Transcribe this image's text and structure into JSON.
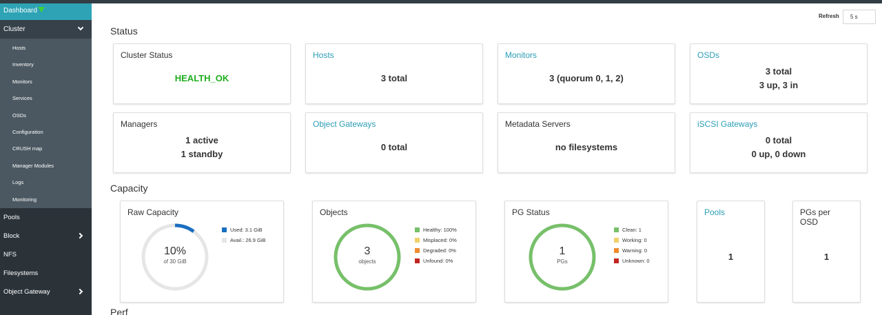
{
  "colors": {
    "accent": "#2ea3b5",
    "link": "#2b9db5",
    "healthy": "#77c06a",
    "ok_text": "#1fad1f",
    "used": "#1a6ec0"
  },
  "sidebar": {
    "dashboard": "Dashboard",
    "cluster": "Cluster",
    "cluster_items": [
      "Hosts",
      "Inventory",
      "Monitors",
      "Services",
      "OSDs",
      "Configuration",
      "CRUSH map",
      "Manager Modules",
      "Logs",
      "Monitoring"
    ],
    "pools": "Pools",
    "block": "Block",
    "nfs": "NFS",
    "filesystems": "Filesystems",
    "object_gateway": "Object Gateway"
  },
  "refresh": {
    "label": "Refresh",
    "value": "5 s"
  },
  "status": {
    "heading": "Status",
    "cluster_status": {
      "title": "Cluster Status",
      "value": "HEALTH_OK"
    },
    "hosts": {
      "title": "Hosts",
      "value": "3 total"
    },
    "monitors": {
      "title": "Monitors",
      "value": "3 (quorum 0, 1, 2)"
    },
    "osds": {
      "title": "OSDs",
      "line1": "3 total",
      "line2": "3 up, 3 in"
    },
    "managers": {
      "title": "Managers",
      "line1": "1 active",
      "line2": "1 standby"
    },
    "object_gateways": {
      "title": "Object Gateways",
      "value": "0 total"
    },
    "metadata_servers": {
      "title": "Metadata Servers",
      "value": "no filesystems"
    },
    "iscsi": {
      "title": "iSCSI Gateways",
      "line1": "0 total",
      "line2": "0 up, 0 down"
    }
  },
  "capacity": {
    "heading": "Capacity",
    "raw": {
      "title": "Raw Capacity",
      "percent": "10%",
      "sub": "of 30 GiB",
      "used_fraction": 0.1,
      "legend": [
        {
          "label": "Used: 3.1 GiB",
          "color": "#1a6ec0"
        },
        {
          "label": "Avail.: 26.9 GiB",
          "color": "#e6e6e6"
        }
      ]
    },
    "objects": {
      "title": "Objects",
      "number": "3",
      "sub": "objects",
      "legend": [
        {
          "label": "Healthy: 100%",
          "color": "#77c06a"
        },
        {
          "label": "Misplaced: 0%",
          "color": "#f2d06b"
        },
        {
          "label": "Degraded: 0%",
          "color": "#ee8c2f"
        },
        {
          "label": "Unfound: 0%",
          "color": "#c0261f"
        }
      ]
    },
    "pg_status": {
      "title": "PG Status",
      "number": "1",
      "sub": "PGs",
      "legend": [
        {
          "label": "Clean: 1",
          "color": "#77c06a"
        },
        {
          "label": "Working: 0",
          "color": "#f2d06b"
        },
        {
          "label": "Warning: 0",
          "color": "#ee8c2f"
        },
        {
          "label": "Unknown: 0",
          "color": "#c0261f"
        }
      ]
    },
    "pools": {
      "title": "Pools",
      "value": "1"
    },
    "pgs_per_osd": {
      "title": "PGs per OSD",
      "value": "1"
    }
  },
  "next_heading": "Perf"
}
